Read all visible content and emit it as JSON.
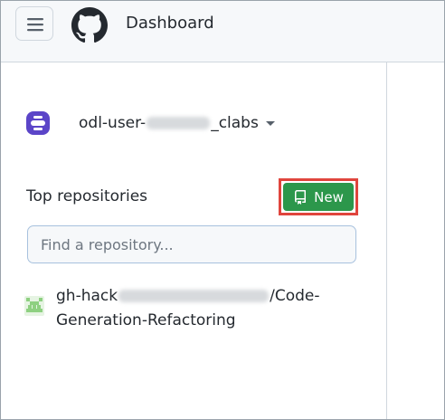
{
  "header": {
    "title": "Dashboard",
    "menu_icon": "hamburger-icon",
    "logo_icon": "github-logo-icon"
  },
  "sidebar": {
    "account": {
      "name_prefix": "odl-user-",
      "name_suffix": "_clabs"
    },
    "repositories": {
      "heading": "Top repositories",
      "new_button_label": "New",
      "search_placeholder": "Find a repository...",
      "items": [
        {
          "owner_prefix": "gh-hack",
          "name_line1_suffix": "/Code-",
          "name_line2": "Generation-Refactoring"
        }
      ]
    }
  },
  "colors": {
    "header_bg": "#f6f8fa",
    "primary_button": "#2c974b",
    "highlight_border": "#e0453d",
    "org_avatar": "#5b45c8",
    "repo_avatar": "#8ed081"
  }
}
